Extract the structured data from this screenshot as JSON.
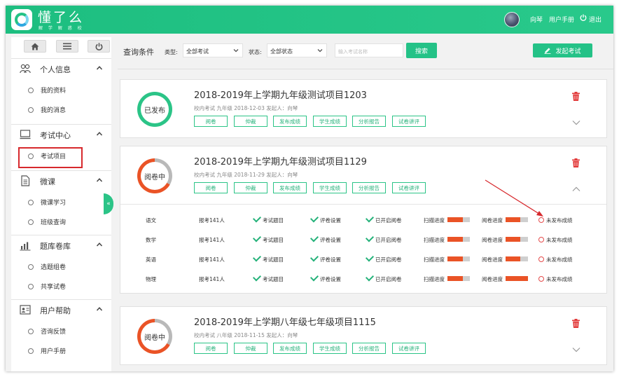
{
  "header": {
    "app_name": "懂了么",
    "app_slogan": "解 学 解 惑 校",
    "user_name": "向琴",
    "manual_link": "用户手册",
    "logout_link": "退出"
  },
  "sidebar": {
    "groups": [
      {
        "label": "个人信息",
        "icon": "user-group-icon",
        "items": [
          "我的资料",
          "我的消息"
        ]
      },
      {
        "label": "考试中心",
        "icon": "monitor-icon",
        "items": [
          "考试项目"
        ]
      },
      {
        "label": "微课",
        "icon": "document-icon",
        "items": [
          "微课学习",
          "班级查询"
        ]
      },
      {
        "label": "题库卷库",
        "icon": "chart-icon",
        "items": [
          "选题组卷",
          "共享试卷"
        ]
      },
      {
        "label": "用户帮助",
        "icon": "contact-card-icon",
        "items": [
          "咨询反馈",
          "用户手册"
        ]
      }
    ],
    "active_item": "考试项目",
    "collapse_glyph": "«"
  },
  "query": {
    "title": "查询条件",
    "type_label": "类型:",
    "type_value": "全部考试",
    "status_label": "状态:",
    "status_value": "全部状态",
    "search_placeholder": "输入考试名称",
    "search_button": "搜索",
    "launch_button": "发起考试"
  },
  "exams": [
    {
      "title": "2018-2019年上学期九年级测试项目1203",
      "meta": "校内考试   九年级   2018-12-03   发起人：向琴",
      "status": "已发布",
      "expanded": false,
      "actions": [
        "阅卷",
        "仲裁",
        "发布成绩",
        "学生成绩",
        "分析报告",
        "试卷讲评"
      ]
    },
    {
      "title": "2018-2019年上学期九年级测试项目1129",
      "meta": "校内考试   九年级   2018-11-29   发起人：向琴",
      "status": "阅卷中",
      "expanded": true,
      "actions": [
        "阅卷",
        "仲裁",
        "发布成绩",
        "学生成绩",
        "分析报告",
        "试卷讲评"
      ],
      "subjects": [
        {
          "name": "语文",
          "registered": "报考141人",
          "questions": "考试题目",
          "review": "评卷设置",
          "grading": "已开启阅卷",
          "scan_label": "扫描进度",
          "scan_progress": 0.7,
          "grade_label": "阅卷进度",
          "grade_progress": 0.65,
          "result": "未发布成绩"
        },
        {
          "name": "数学",
          "registered": "报考141人",
          "questions": "考试题目",
          "review": "评卷设置",
          "grading": "已开启阅卷",
          "scan_label": "扫描进度",
          "scan_progress": 0.7,
          "grade_label": "阅卷进度",
          "grade_progress": 0.65,
          "result": "未发布成绩"
        },
        {
          "name": "英语",
          "registered": "报考141人",
          "questions": "考试题目",
          "review": "评卷设置",
          "grading": "已开启阅卷",
          "scan_label": "扫描进度",
          "scan_progress": 0.7,
          "grade_label": "阅卷进度",
          "grade_progress": 0.65,
          "result": "未发布成绩"
        },
        {
          "name": "物理",
          "registered": "报考141人",
          "questions": "考试题目",
          "review": "评卷设置",
          "grading": "已开启阅卷",
          "scan_label": "扫描进度",
          "scan_progress": 0.7,
          "grade_label": "阅卷进度",
          "grade_progress": 1.0,
          "result": "未发布成绩"
        }
      ]
    },
    {
      "title": "2018-2019年上学期八年级七年级项目1115",
      "meta": "校内考试   八年级   2018-11-15   发起人：向琴",
      "status": "阅卷中",
      "expanded": false,
      "actions": [
        "阅卷",
        "仲裁",
        "发布成绩",
        "学生成绩",
        "分析报告",
        "试卷讲评"
      ]
    }
  ],
  "colors": {
    "brand": "#24c287",
    "progress": "#ea5326",
    "highlight": "#d7292d"
  }
}
